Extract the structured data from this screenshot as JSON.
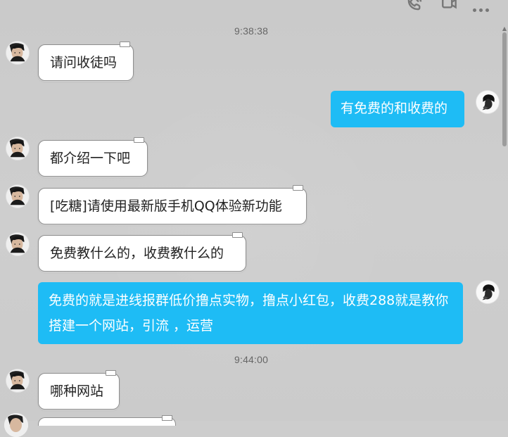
{
  "header": {
    "actions": [
      {
        "icon": "phone-icon"
      },
      {
        "icon": "video-icon"
      },
      {
        "icon": "more-icon"
      }
    ]
  },
  "scrollbar": {
    "position": "top"
  },
  "messages": [
    {
      "type": "timestamp",
      "text": "9:38:38"
    },
    {
      "type": "incoming",
      "text": "请问收徒吗",
      "avatar_icon": "user-avatar"
    },
    {
      "type": "outgoing",
      "text": "有免费的和收费的",
      "avatar_icon": "self-avatar"
    },
    {
      "type": "incoming",
      "text": "都介绍一下吧",
      "avatar_icon": "user-avatar"
    },
    {
      "type": "incoming",
      "text": "[吃糖]请使用最新版手机QQ体验新功能",
      "avatar_icon": "user-avatar"
    },
    {
      "type": "incoming",
      "text": "免费教什么的，收费教什么的",
      "avatar_icon": "user-avatar"
    },
    {
      "type": "outgoing",
      "text": "免费的就是进线报群低价撸点实物，撸点小红包，收费288就是教你搭建一个网站，引流 ，运营",
      "avatar_icon": "self-avatar"
    },
    {
      "type": "timestamp",
      "text": "9:44:00"
    },
    {
      "type": "incoming",
      "text": "哪种网站",
      "avatar_icon": "user-avatar"
    }
  ]
}
